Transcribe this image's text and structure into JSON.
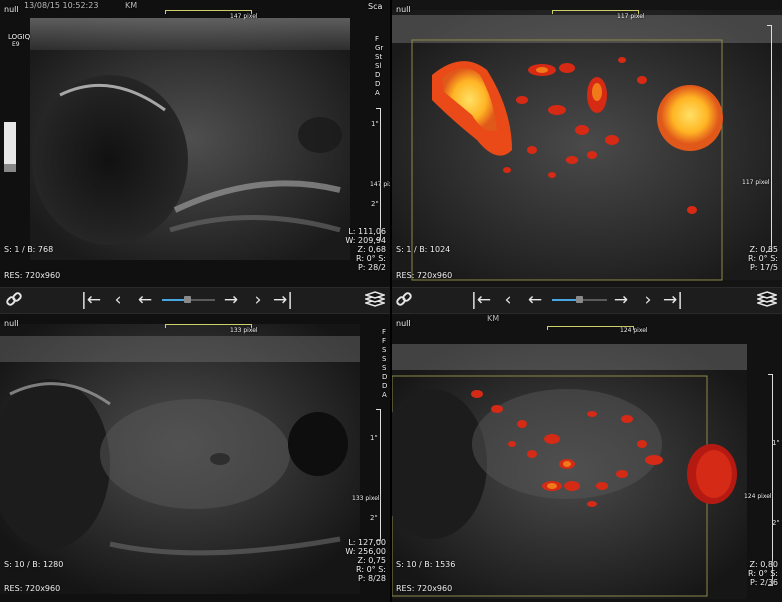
{
  "viewports": [
    {
      "header_label": "null",
      "timestamp": "13/08/15 10:52:23",
      "operator": "KM",
      "scale_label": "147 pixel",
      "side_label": "147 pixel",
      "logo_line1": "LOGIQ",
      "logo_line2": "E9",
      "right_text": "Sca",
      "side_menu": [
        "F",
        "Gr",
        "St",
        "Sl",
        "D",
        "D",
        "A"
      ],
      "slice": "S: 1 / B: 768",
      "res": "RES: 720x960",
      "params": [
        "L: 111,06",
        "W: 209,94",
        "Z: 0,68",
        "R: 0° S:",
        "P: 28/2"
      ],
      "ticks": [
        "1\"",
        "2\""
      ]
    },
    {
      "header_label": "null",
      "timestamp": "",
      "operator": "",
      "scale_label": "117 pixel",
      "side_label": "117 pixel",
      "slice": "S: 1 / B: 1024",
      "res": "RES: 720x960",
      "params": [
        "Z: 0,85",
        "R: 0° S:",
        "P: 17/5"
      ]
    },
    {
      "header_label": "null",
      "timestamp": "",
      "operator": "",
      "scale_label": "133 pixel",
      "side_label": "133 pixel",
      "side_menu": [
        "F",
        "F",
        "S",
        "S",
        "S",
        "D",
        "D",
        "A"
      ],
      "slice": "S: 10 / B: 1280",
      "res": "RES: 720x960",
      "params": [
        "L: 127,00",
        "W: 256,00",
        "Z: 0,75",
        "R: 0° S:",
        "P: 8/28"
      ],
      "ticks": [
        "1\"",
        "2\""
      ]
    },
    {
      "header_label": "null",
      "timestamp": "",
      "operator": "KM",
      "scale_label": "124 pixel",
      "side_label": "124 pixel",
      "slice": "S: 10 / B: 1536",
      "res": "RES: 720x960",
      "params": [
        "Z: 0,80",
        "R: 0° S:",
        "P: 2/36"
      ],
      "ticks": [
        "1\"",
        "2\""
      ]
    }
  ],
  "toolbar": {
    "buttons": [
      "link-icon",
      "first-frame-icon",
      "prev-frame-icon",
      "rewind-icon",
      "forward-icon",
      "next-frame-icon",
      "last-frame-icon",
      "layers-icon"
    ]
  },
  "colors": {
    "selected_border": "#5b5fd6",
    "doppler_hot": "#ffd23a",
    "doppler_mid": "#f07a1a",
    "doppler_low": "#c41b12",
    "slider_blue": "#4aa6e0"
  }
}
